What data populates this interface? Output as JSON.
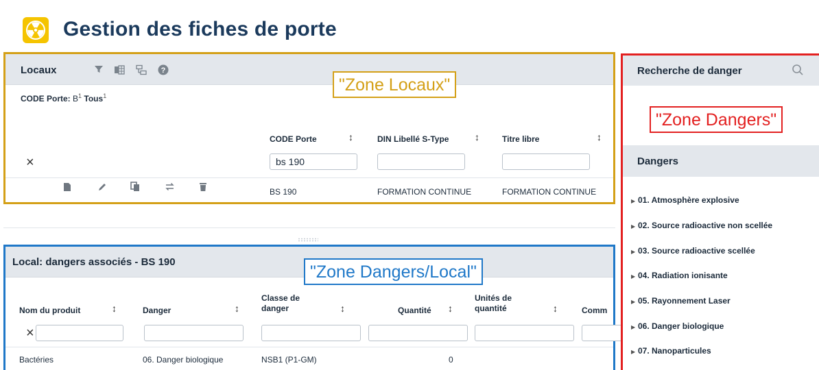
{
  "page": {
    "title": "Gestion des fiches de porte",
    "app_icon": "radiation-icon"
  },
  "locaux": {
    "title": "Locaux",
    "toolbar_icons": [
      "filter-icon",
      "excel-export-icon",
      "columns-icon",
      "help-icon"
    ],
    "filter_summary": {
      "label": "CODE Porte:",
      "value": "B",
      "value_count": "1",
      "all": "Tous",
      "all_count": "1"
    },
    "columns": [
      "CODE Porte",
      "DIN Libellé S-Type",
      "Titre libre"
    ],
    "filter_values": [
      "bs 190",
      "",
      ""
    ],
    "clear_filter": "×",
    "row_actions": [
      "file-icon",
      "edit-icon",
      "copy-icon",
      "swap-icon",
      "delete-icon"
    ],
    "rows": [
      [
        "BS 190",
        "FORMATION CONTINUE",
        "FORMATION CONTINUE"
      ]
    ]
  },
  "dangers_local": {
    "title": "Local: dangers associés - BS 190",
    "columns": [
      "Nom du produit",
      "Danger",
      "Classe de danger",
      "Quantité",
      "Unités de quantité",
      "Comm"
    ],
    "clear_filter": "×",
    "rows": [
      [
        "Bactéries",
        "06. Danger biologique",
        "NSB1 (P1-GM)",
        "0",
        "",
        ""
      ]
    ]
  },
  "dangers_panel": {
    "search_title": "Recherche de danger",
    "title": "Dangers",
    "items": [
      "01. Atmosphère explosive",
      "02. Source radioactive non scellée",
      "03. Source radioactive scellée",
      "04. Radiation ionisante",
      "05. Rayonnement Laser",
      "06. Danger biologique",
      "07. Nanoparticules"
    ]
  },
  "annotations": {
    "zone_locaux": "\"Zone Locaux\"",
    "zone_dangers_local": "\"Zone Dangers/Local\"",
    "zone_dangers": "\"Zone Dangers\""
  },
  "colors": {
    "zone_locaux": "#d4a017",
    "zone_dangers_local": "#1f78c8",
    "zone_dangers": "#e32020",
    "title": "#1b3a5c",
    "icon_yellow": "#f5c400"
  }
}
